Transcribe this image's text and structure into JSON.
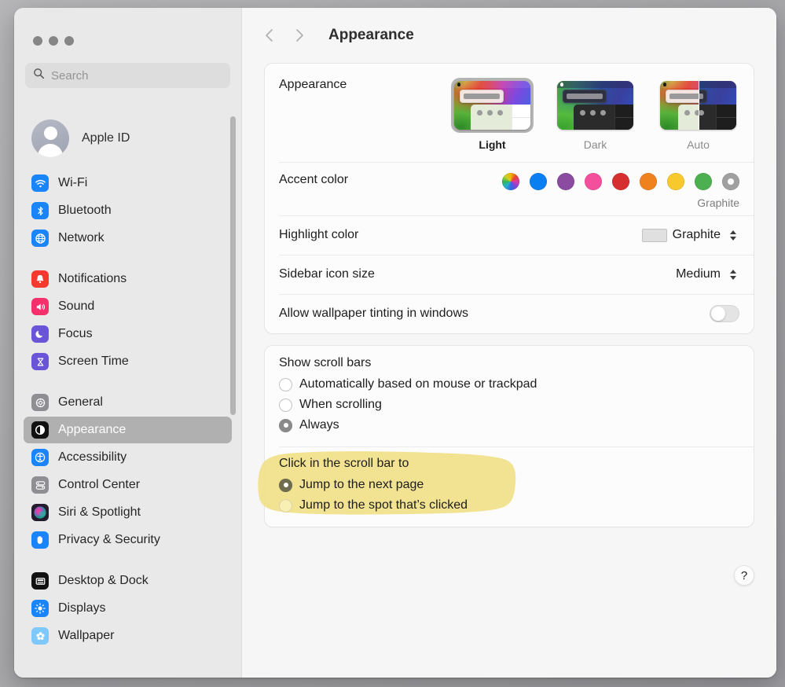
{
  "window": {
    "traffic_lights": [
      "close",
      "minimize",
      "zoom"
    ]
  },
  "sidebar": {
    "search": {
      "placeholder": "Search",
      "value": "",
      "icon": "search-icon"
    },
    "account": {
      "label": "Apple ID",
      "icon": "avatar-placeholder-icon"
    },
    "groups": [
      {
        "items": [
          {
            "label": "Wi-Fi",
            "icon": "wifi-icon",
            "color": "#1a84fb",
            "selected": false
          },
          {
            "label": "Bluetooth",
            "icon": "bluetooth-icon",
            "color": "#1a84fb",
            "selected": false
          },
          {
            "label": "Network",
            "icon": "globe-icon",
            "color": "#1a84fb",
            "selected": false
          }
        ]
      },
      {
        "items": [
          {
            "label": "Notifications",
            "icon": "bell-icon",
            "color": "#f5392e",
            "selected": false
          },
          {
            "label": "Sound",
            "icon": "speaker-icon",
            "color": "#f5306a",
            "selected": false
          },
          {
            "label": "Focus",
            "icon": "moon-icon",
            "color": "#6a54d8",
            "selected": false
          },
          {
            "label": "Screen Time",
            "icon": "hourglass-icon",
            "color": "#6a54d8",
            "selected": false
          }
        ]
      },
      {
        "items": [
          {
            "label": "General",
            "icon": "gear-icon",
            "color": "#8e8e93",
            "selected": false
          },
          {
            "label": "Appearance",
            "icon": "appearance-contrast-icon",
            "color": "#111111",
            "selected": true
          },
          {
            "label": "Accessibility",
            "icon": "accessibility-icon",
            "color": "#1a84fb",
            "selected": false
          },
          {
            "label": "Control Center",
            "icon": "control-center-icon",
            "color": "#8e8e93",
            "selected": false
          },
          {
            "label": "Siri & Spotlight",
            "icon": "siri-icon",
            "color": "#3a2b4d",
            "selected": false
          },
          {
            "label": "Privacy & Security",
            "icon": "hand-raised-icon",
            "color": "#1a84fb",
            "selected": false
          }
        ]
      },
      {
        "items": [
          {
            "label": "Desktop & Dock",
            "icon": "desktop-dock-icon",
            "color": "#111111",
            "selected": false
          },
          {
            "label": "Displays",
            "icon": "brightness-icon",
            "color": "#1a84fb",
            "selected": false
          },
          {
            "label": "Wallpaper",
            "icon": "wallpaper-icon",
            "color": "#7ec8fb",
            "selected": false
          }
        ]
      }
    ]
  },
  "toolbar": {
    "back_icon": "chevron-left-icon",
    "forward_icon": "chevron-right-icon",
    "title": "Appearance"
  },
  "appearance_section": {
    "label": "Appearance",
    "modes": [
      {
        "label": "Light",
        "selected": true
      },
      {
        "label": "Dark",
        "selected": false
      },
      {
        "label": "Auto",
        "selected": false
      }
    ],
    "accent": {
      "label": "Accent color",
      "selected_name": "Graphite",
      "swatches": [
        {
          "name": "Multicolor",
          "color": "multicolor",
          "selected": false
        },
        {
          "name": "Blue",
          "color": "#0a7ff2",
          "selected": false
        },
        {
          "name": "Purple",
          "color": "#8a4ba0",
          "selected": false
        },
        {
          "name": "Pink",
          "color": "#f34f9c",
          "selected": false
        },
        {
          "name": "Red",
          "color": "#d5302f",
          "selected": false
        },
        {
          "name": "Orange",
          "color": "#f0821e",
          "selected": false
        },
        {
          "name": "Yellow",
          "color": "#f7c92d",
          "selected": false
        },
        {
          "name": "Green",
          "color": "#4cb050",
          "selected": false
        },
        {
          "name": "Graphite",
          "color": "#a0a0a0",
          "selected": true
        }
      ]
    },
    "highlight_color": {
      "label": "Highlight color",
      "value": "Graphite",
      "swatch": "#e0e0e0"
    },
    "sidebar_icon_size": {
      "label": "Sidebar icon size",
      "value": "Medium"
    },
    "wallpaper_tinting": {
      "label": "Allow wallpaper tinting in windows",
      "enabled": false
    }
  },
  "scrollbars_section": {
    "show_scroll_bars": {
      "title": "Show scroll bars",
      "options": [
        {
          "label": "Automatically based on mouse or trackpad",
          "selected": false
        },
        {
          "label": "When scrolling",
          "selected": false
        },
        {
          "label": "Always",
          "selected": true
        }
      ]
    },
    "click_in_scroll_bar": {
      "title": "Click in the scroll bar to",
      "highlighted": true,
      "highlight_color": "#f0e188",
      "options": [
        {
          "label": "Jump to the next page",
          "selected": true
        },
        {
          "label": "Jump to the spot that’s clicked",
          "selected": false
        }
      ]
    }
  },
  "help": {
    "label": "?"
  }
}
